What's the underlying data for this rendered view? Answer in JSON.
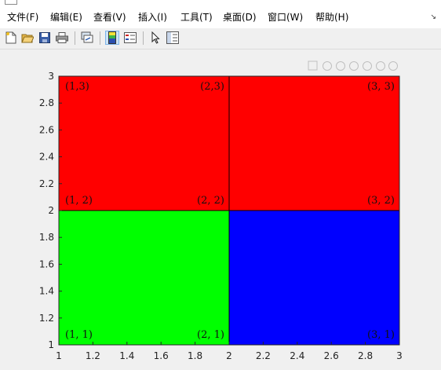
{
  "menubar": {
    "items": [
      {
        "label": "文件(F)"
      },
      {
        "label": "编辑(E)"
      },
      {
        "label": "查看(V)"
      },
      {
        "label": "插入(I)"
      },
      {
        "label": "工具(T)"
      },
      {
        "label": "桌面(D)"
      },
      {
        "label": "窗口(W)"
      },
      {
        "label": "帮助(H)"
      }
    ]
  },
  "toolbar": {
    "icons": [
      "new-figure-icon",
      "open-file-icon",
      "save-icon",
      "print-icon",
      "link-plot-icon",
      "insert-colorbar-icon",
      "insert-legend-icon",
      "edit-plot-arrow-icon",
      "property-inspector-icon"
    ],
    "pressed": "insert-colorbar-icon"
  },
  "axes_toolbar": {
    "icons": [
      "export-icon",
      "brush-icon",
      "datatip-icon",
      "pan-icon",
      "zoom-in-icon",
      "zoom-out-icon",
      "home-icon"
    ]
  },
  "chart_data": {
    "type": "heatmap",
    "title": "",
    "xlabel": "",
    "ylabel": "",
    "xlim": [
      1,
      3
    ],
    "ylim": [
      1,
      3
    ],
    "xticks": [
      "1",
      "1.2",
      "1.4",
      "1.6",
      "1.8",
      "2",
      "2.2",
      "2.4",
      "2.6",
      "2.8",
      "3"
    ],
    "yticks": [
      "1",
      "1.2",
      "1.4",
      "1.6",
      "1.8",
      "2",
      "2.2",
      "2.4",
      "2.6",
      "2.8",
      "3"
    ],
    "grid": false,
    "cells": [
      {
        "x": [
          1,
          2
        ],
        "y": [
          2,
          3
        ],
        "color": "#ff0000"
      },
      {
        "x": [
          2,
          3
        ],
        "y": [
          2,
          3
        ],
        "color": "#ff0000"
      },
      {
        "x": [
          1,
          2
        ],
        "y": [
          1,
          2
        ],
        "color": "#00ff00"
      },
      {
        "x": [
          2,
          3
        ],
        "y": [
          1,
          2
        ],
        "color": "#0000ff"
      }
    ],
    "annotations": [
      {
        "text": "(1,3)",
        "x": 1,
        "y": 3,
        "anchor": "top-left"
      },
      {
        "text": "(2,3)",
        "x": 2,
        "y": 3,
        "anchor": "top-right"
      },
      {
        "text": "(3, 3)",
        "x": 3,
        "y": 3,
        "anchor": "top-right"
      },
      {
        "text": "(1, 2)",
        "x": 1,
        "y": 2,
        "anchor": "bottom-left"
      },
      {
        "text": "(2, 2)",
        "x": 2,
        "y": 2,
        "anchor": "bottom-right"
      },
      {
        "text": "(3, 2)",
        "x": 3,
        "y": 2,
        "anchor": "bottom-right"
      },
      {
        "text": "(1, 1)",
        "x": 1,
        "y": 1,
        "anchor": "bottom-left"
      },
      {
        "text": "(2, 1)",
        "x": 2,
        "y": 1,
        "anchor": "bottom-right"
      },
      {
        "text": "(3, 1)",
        "x": 3,
        "y": 1,
        "anchor": "bottom-right"
      }
    ]
  }
}
